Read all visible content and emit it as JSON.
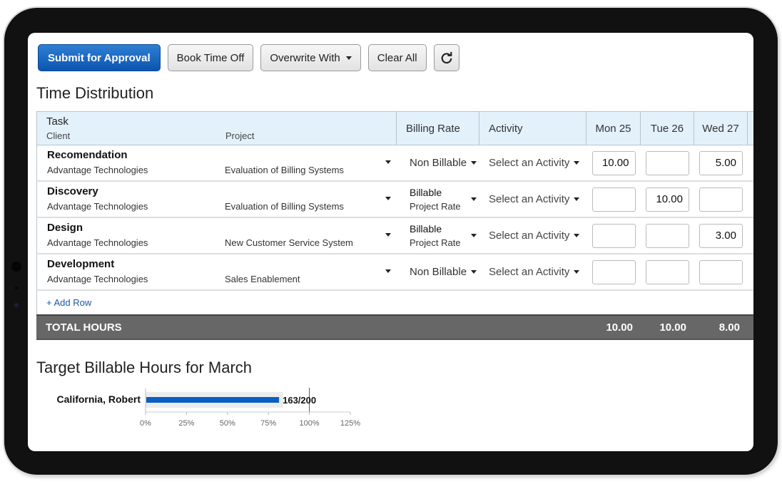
{
  "toolbar": {
    "submit": "Submit for Approval",
    "book_time_off": "Book Time Off",
    "overwrite_with": "Overwrite With",
    "clear_all": "Clear All",
    "refresh_icon": "refresh-icon"
  },
  "time_distribution": {
    "title": "Time Distribution",
    "headers": {
      "task": "Task",
      "client": "Client",
      "project": "Project",
      "billing_rate": "Billing Rate",
      "activity": "Activity",
      "days": [
        "Mon 25",
        "Tue 26",
        "Wed 27"
      ]
    },
    "rows": [
      {
        "task": "Recomendation",
        "client": "Advantage Technologies",
        "project": "Evaluation of Billing Systems",
        "rate": "Non Billable",
        "rate_sub": "",
        "activity": "Select an Activity",
        "hours": [
          "10.00",
          "",
          "5.00"
        ]
      },
      {
        "task": "Discovery",
        "client": "Advantage Technologies",
        "project": "Evaluation of Billing Systems",
        "rate": "Billable",
        "rate_sub": "Project Rate",
        "activity": "Select an Activity",
        "hours": [
          "",
          "10.00",
          ""
        ]
      },
      {
        "task": "Design",
        "client": "Advantage Technologies",
        "project": "New Customer Service System",
        "rate": "Billable",
        "rate_sub": "Project Rate",
        "activity": "Select an Activity",
        "hours": [
          "",
          "",
          "3.00"
        ]
      },
      {
        "task": "Development",
        "client": "Advantage Technologies",
        "project": "Sales Enablement",
        "rate": "Non Billable",
        "rate_sub": "",
        "activity": "Select an Activity",
        "hours": [
          "",
          "",
          ""
        ]
      }
    ],
    "add_row": "+ Add Row",
    "total_label": "TOTAL HOURS",
    "totals": [
      "10.00",
      "10.00",
      "8.00"
    ]
  },
  "target": {
    "title": "Target Billable Hours for March",
    "colors": {
      "bar": "#0b5fc4",
      "band": "#ececec"
    },
    "chart_data": {
      "type": "bar",
      "categories": [
        "California, Robert"
      ],
      "values": [
        163
      ],
      "target": 200,
      "value_label": "163/200",
      "percent": 81.5,
      "band_percent": 84,
      "xticks": [
        "0%",
        "25%",
        "50%",
        "75%",
        "100%",
        "125%"
      ],
      "xlim": [
        0,
        125
      ]
    }
  }
}
